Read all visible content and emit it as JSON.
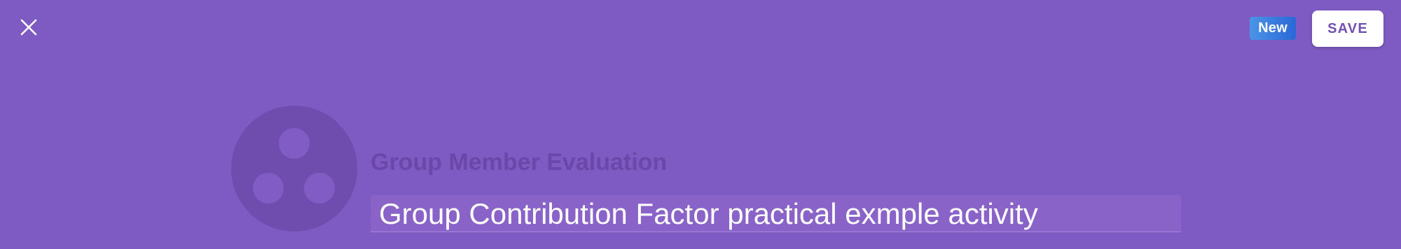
{
  "header": {
    "close_icon": "close-icon",
    "badge_label": "New",
    "save_label": "SAVE"
  },
  "activity": {
    "type_label": "Group Member Evaluation",
    "title": "Group Contribution Factor practical exmple activity",
    "icon": "group-icon"
  },
  "colors": {
    "background": "#7e5bc2",
    "badge_start": "#4a95e6",
    "badge_end": "#2a67d8",
    "save_text": "#7250b4"
  }
}
